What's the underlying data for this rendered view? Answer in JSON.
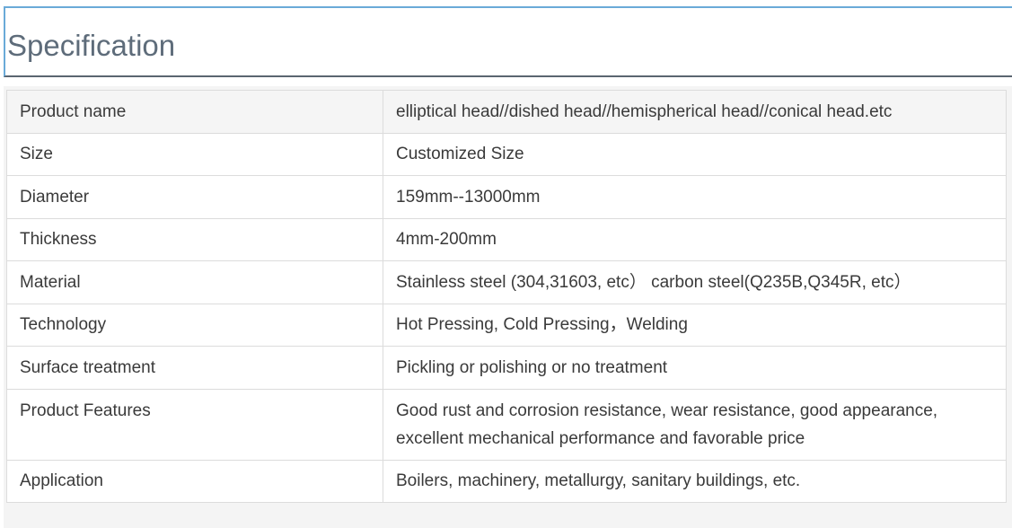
{
  "header": {
    "title": "Specification"
  },
  "spec_table": {
    "rows": [
      {
        "label": "Product name",
        "value": "elliptical head//dished head//hemispherical head//conical head.etc"
      },
      {
        "label": "Size",
        "value": "Customized Size"
      },
      {
        "label": "Diameter",
        "value": "159mm--13000mm"
      },
      {
        "label": "Thickness",
        "value": "4mm-200mm"
      },
      {
        "label": "Material",
        "value": "Stainless steel (304,31603, etc） carbon steel(Q235B,Q345R, etc）"
      },
      {
        "label": "Technology",
        "value": "Hot Pressing, Cold Pressing，Welding"
      },
      {
        "label": "Surface treatment",
        "value": "Pickling or polishing or no treatment"
      },
      {
        "label": "Product Features",
        "value": "Good rust and corrosion resistance, wear resistance, good appearance, excellent mechanical performance and favorable price"
      },
      {
        "label": "Application",
        "value": "Boilers, machinery, metallurgy, sanitary buildings, etc."
      }
    ]
  },
  "colors": {
    "header_border": "#6aaad8",
    "header_underline": "#5b6570",
    "title_text": "#5e6c7a",
    "cell_text": "#3a3a3a",
    "cell_border": "#dcdcdc"
  }
}
